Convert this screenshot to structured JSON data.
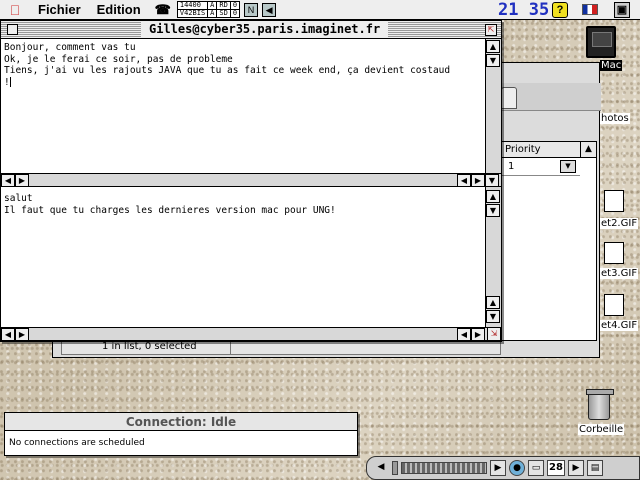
{
  "menubar": {
    "apple_icon": "apple-menu-icon",
    "menus": [
      "Fichier",
      "Edition"
    ],
    "modem_status": {
      "row1": [
        "14400",
        "A",
        "RD",
        "0"
      ],
      "row2": [
        "V42BIS",
        "A",
        "SD",
        "0"
      ],
      "n_label": "N"
    },
    "clock": "21 35",
    "icons": [
      "phone-icon",
      "help-icon",
      "french-flag-icon",
      "application-icon"
    ]
  },
  "chat_window": {
    "title": "Gilles@cyber35.paris.imaginet.fr",
    "incoming_text": "Bonjour, comment vas tu\nOk, je le ferai ce soir, pas de probleme\nTiens, j'ai vu les rajouts JAVA que tu as fait ce week end, ça devient costaud\n!",
    "outgoing_text": "salut\nIl faut que tu charges les dernieres version mac pour UNG!"
  },
  "background_window": {
    "priority_column": {
      "header": "Priority",
      "row_value": "1"
    },
    "status_text": "1 in list, 0 selected"
  },
  "desktop": {
    "mac_label": "Mac",
    "photos_label": "hotos",
    "gif_labels": [
      "et2.GIF",
      "et3.GIF",
      "et4.GIF"
    ],
    "trash_label": "Corbeille"
  },
  "connection_window": {
    "title": "Connection: Idle",
    "message": "No connections are scheduled"
  },
  "control_strip": {
    "page_number": "28"
  }
}
